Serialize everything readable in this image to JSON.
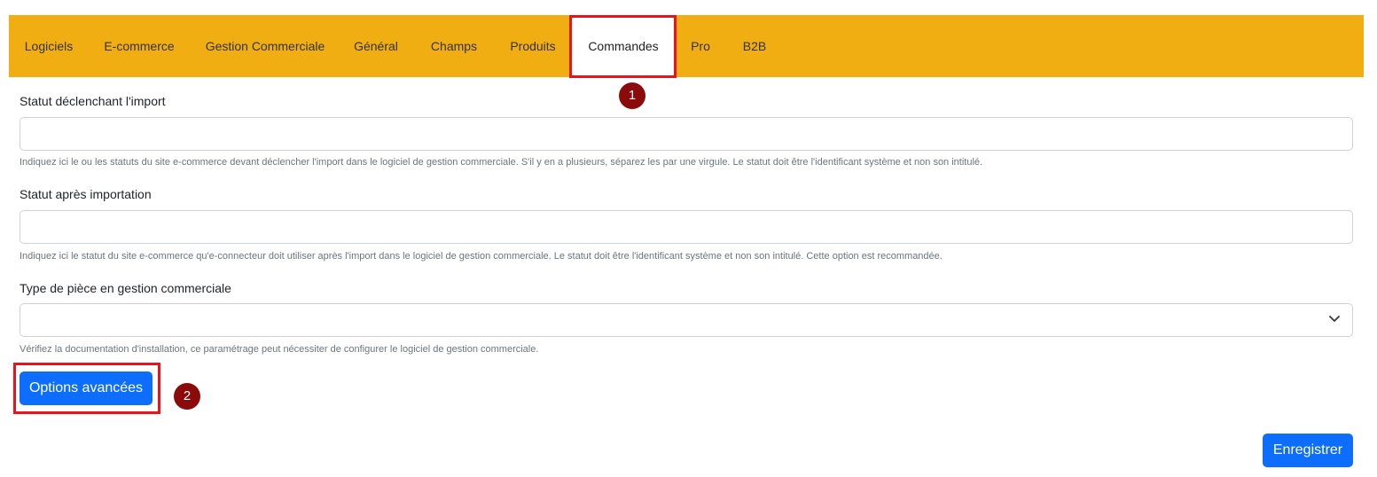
{
  "tabs": [
    {
      "label": "Logiciels"
    },
    {
      "label": "E-commerce"
    },
    {
      "label": "Gestion Commerciale"
    },
    {
      "label": "Général"
    },
    {
      "label": "Champs"
    },
    {
      "label": "Produits"
    },
    {
      "label": "Commandes",
      "active": true
    },
    {
      "label": "Pro"
    },
    {
      "label": "B2B"
    }
  ],
  "form": {
    "import_status": {
      "label": "Statut déclenchant l'import",
      "value": "",
      "help": "Indiquez ici le ou les statuts du site e-commerce devant déclencher l'import dans le logiciel de gestion commerciale. S'il y en a plusieurs, séparez les par une virgule. Le statut doit être l'identificant système et non son intitulé."
    },
    "after_import_status": {
      "label": "Statut après importation",
      "value": "",
      "help": "Indiquez ici le statut du site e-commerce qu'e-connecteur doit utiliser après l'import dans le logiciel de gestion commerciale. Le statut doit être l'identificant système et non son intitulé. Cette option est recommandée."
    },
    "document_type": {
      "label": "Type de pièce en gestion commerciale",
      "selected": "",
      "help": "Vérifiez la documentation d'installation, ce paramétrage peut nécessiter de configurer le logiciel de gestion commerciale."
    }
  },
  "buttons": {
    "advanced_options": "Options avancées",
    "save": "Enregistrer"
  },
  "annotations": {
    "marker_1": "1",
    "marker_2": "2"
  },
  "colors": {
    "tabbar": "#f0ae12",
    "primary": "#0d6efd",
    "highlight": "#e8131b",
    "marker": "#8b0a0a"
  }
}
